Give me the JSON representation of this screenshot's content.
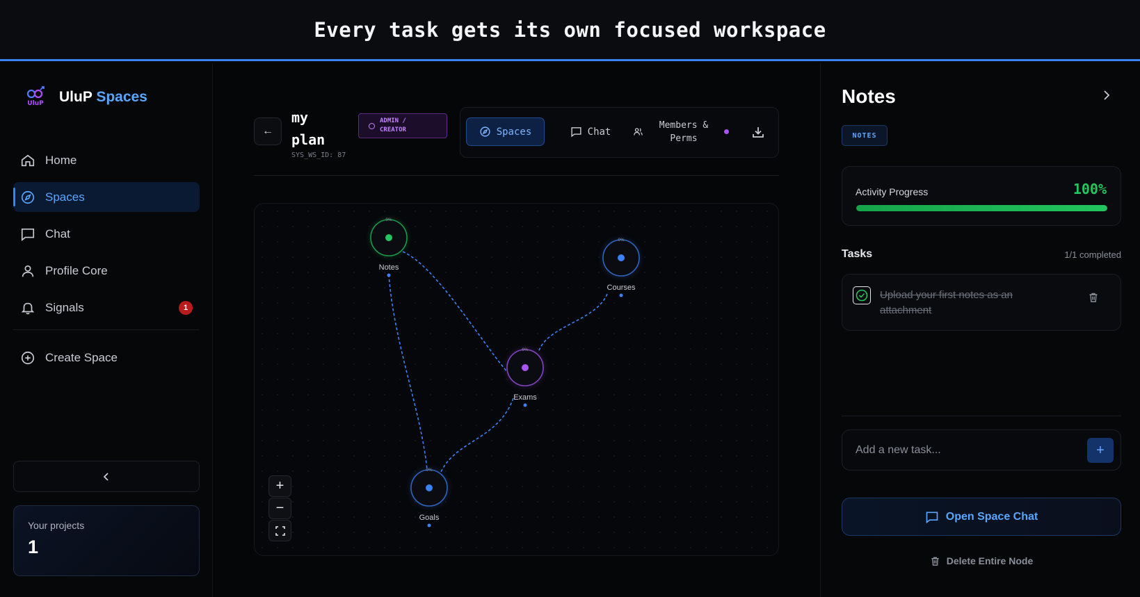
{
  "banner": {
    "text": "Every task gets its own focused workspace"
  },
  "brand": {
    "name": "UluP",
    "accent": "Spaces",
    "logo_text": "UluP"
  },
  "sidebar": {
    "items": [
      {
        "label": "Home",
        "icon": "home-icon"
      },
      {
        "label": "Spaces",
        "icon": "compass-icon",
        "active": true
      },
      {
        "label": "Chat",
        "icon": "chat-icon"
      },
      {
        "label": "Profile Core",
        "icon": "user-icon"
      },
      {
        "label": "Signals",
        "icon": "bell-icon",
        "badge": "1"
      }
    ],
    "create_label": "Create Space",
    "projects": {
      "label": "Your projects",
      "count": "1"
    }
  },
  "workspace": {
    "title": "my plan",
    "id_label": "SYS_WS_ID: 87",
    "role_line1": "ADMIN /",
    "role_line2": "CREATOR",
    "tabs": {
      "spaces": "Spaces",
      "chat": "Chat",
      "members": "Members & Perms"
    }
  },
  "graph": {
    "nodes": [
      {
        "id": "notes",
        "label": "Notes",
        "percent": "0%",
        "color": "#22c55e"
      },
      {
        "id": "courses",
        "label": "Courses",
        "percent": "0%",
        "color": "#3b82f6"
      },
      {
        "id": "exams",
        "label": "Exams",
        "percent": "0%",
        "color": "#a855f7"
      },
      {
        "id": "goals",
        "label": "Goals",
        "percent": "0%",
        "color": "#3b82f6"
      }
    ],
    "edges": [
      [
        "notes",
        "exams"
      ],
      [
        "notes",
        "goals"
      ],
      [
        "courses",
        "exams"
      ],
      [
        "exams",
        "goals"
      ]
    ]
  },
  "panel": {
    "title": "Notes",
    "tag": "NOTES",
    "progress_label": "Activity Progress",
    "progress_value": "100%",
    "progress_fraction": 1.0,
    "tasks_title": "Tasks",
    "tasks_count": "1/1 completed",
    "tasks": [
      {
        "text": "Upload your first notes as an attachment",
        "done": true
      }
    ],
    "new_task_placeholder": "Add a new task...",
    "open_chat_label": "Open Space Chat",
    "delete_label": "Delete Entire Node"
  },
  "colors": {
    "accent": "#3b82f6",
    "success": "#22c55e",
    "purple": "#a855f7",
    "danger": "#b91c1c"
  }
}
